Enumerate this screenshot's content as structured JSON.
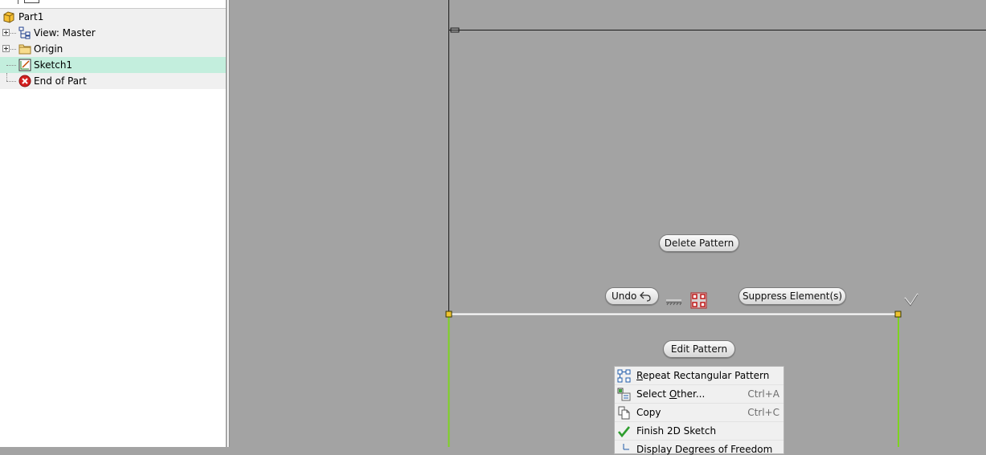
{
  "browser": {
    "items": [
      {
        "label": "Part1",
        "icon": "part-icon"
      },
      {
        "label": "View: Master",
        "icon": "view-icon"
      },
      {
        "label": "Origin",
        "icon": "folder-icon"
      },
      {
        "label": "Sketch1",
        "icon": "sketch-icon"
      },
      {
        "label": "End of Part",
        "icon": "end-of-part-icon"
      }
    ]
  },
  "minitoolbar": {
    "delete_pattern": "Delete Pattern",
    "undo": "Undo",
    "suppress": "Suppress Element(s)",
    "edit_pattern": "Edit Pattern"
  },
  "context_menu": {
    "items": [
      {
        "label": "Repeat Rectangular Pattern",
        "mnemonic": "R",
        "rest": "epeat Rectangular Pattern",
        "shortcut": "",
        "icon": "rectangular-pattern-icon"
      },
      {
        "label": "Select Other...",
        "prefix": "Select ",
        "mnemonic": "O",
        "rest": "ther...",
        "shortcut": "Ctrl+A",
        "icon": "select-other-icon"
      },
      {
        "label": "Copy",
        "shortcut": "Ctrl+C",
        "icon": "copy-icon"
      },
      {
        "label": "Finish 2D Sketch",
        "shortcut": "",
        "icon": "checkmark-icon"
      },
      {
        "label": "Display Degrees of Freedom",
        "shortcut": "",
        "icon": "dof-icon"
      }
    ]
  },
  "colors": {
    "canvas": "#a3a3a3",
    "selected_row": "#c3eedd",
    "sketch_line_green": "#7ed321",
    "selected_line_white": "#ffffff"
  }
}
